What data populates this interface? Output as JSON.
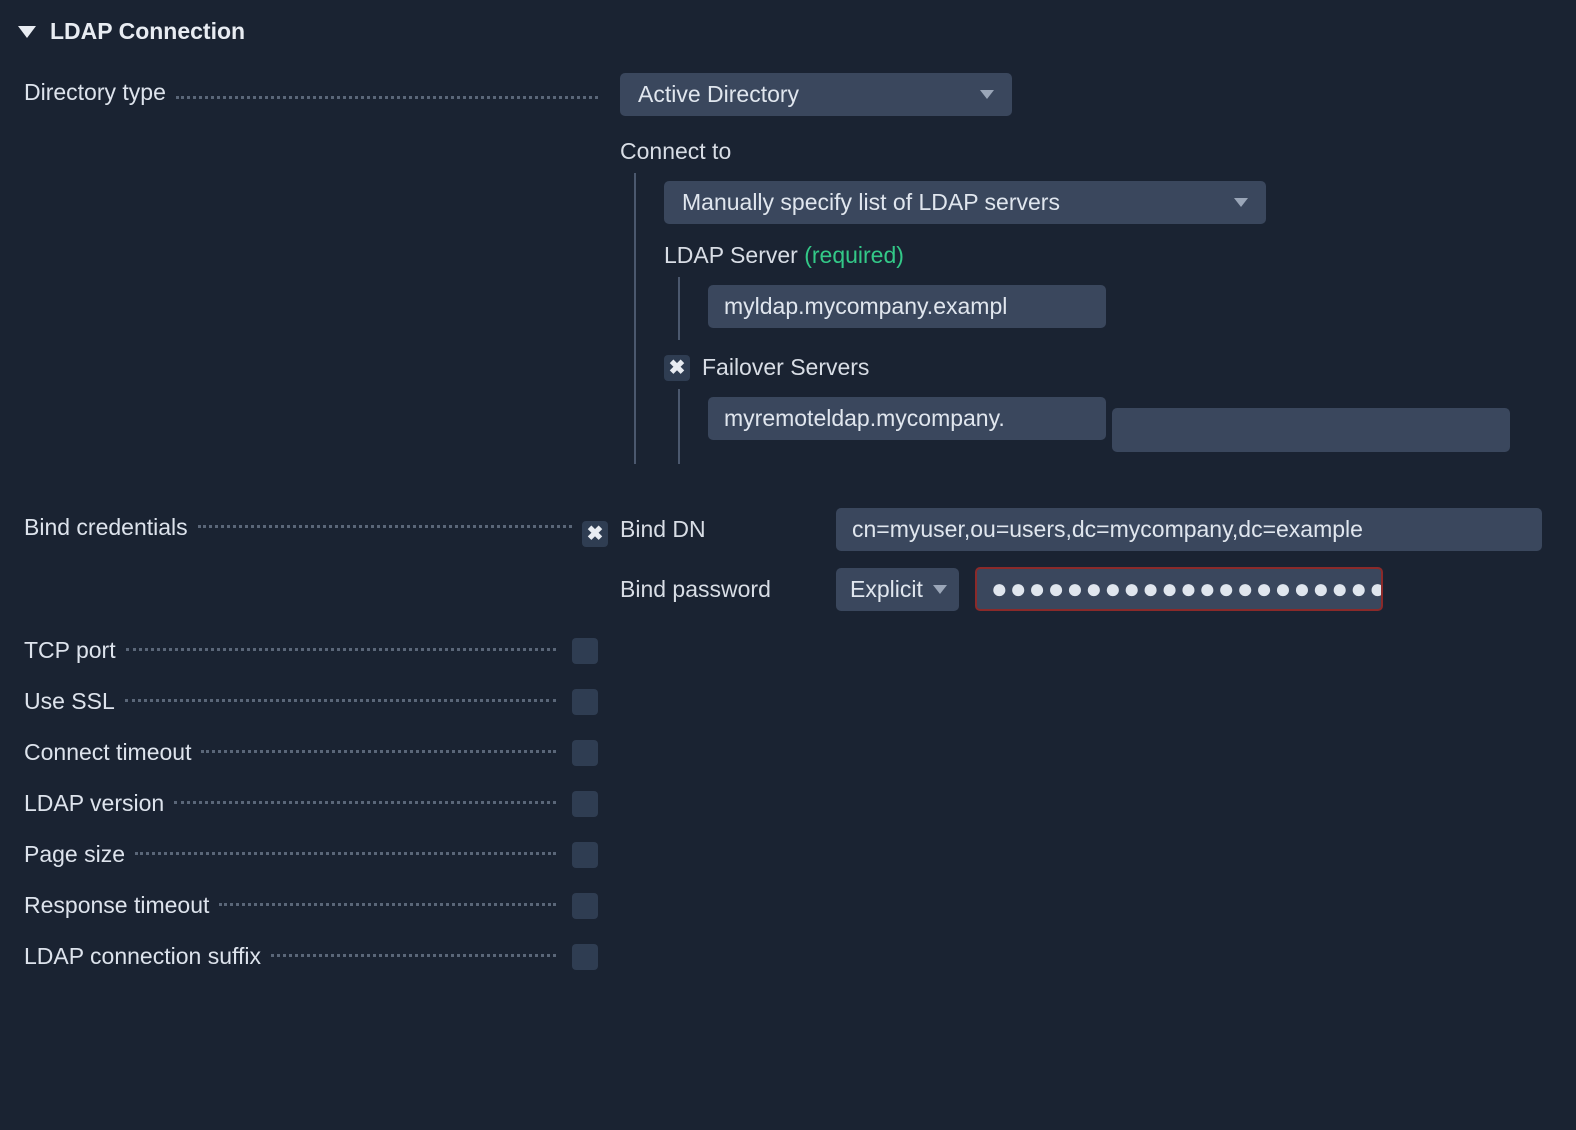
{
  "section_title": "LDAP Connection",
  "directory_type": {
    "label": "Directory type",
    "selected": "Active Directory"
  },
  "connect_to": {
    "label": "Connect to",
    "selected": "Manually specify list of LDAP servers"
  },
  "ldap_server": {
    "label": "LDAP Server",
    "required_text": "(required)",
    "value": "myldap.mycompany.exampl"
  },
  "failover": {
    "label": "Failover Servers",
    "values": [
      "myremoteldap.mycompany.",
      ""
    ]
  },
  "bind": {
    "label": "Bind credentials",
    "dn_label": "Bind DN",
    "dn_value": "cn=myuser,ou=users,dc=mycompany,dc=example",
    "pw_label": "Bind password",
    "pw_mode": "Explicit",
    "pw_masked": "●●●●●●●●●●●●●●●●●●●●●"
  },
  "options": [
    "TCP port",
    "Use SSL",
    "Connect timeout",
    "LDAP version",
    "Page size",
    "Response timeout",
    "LDAP connection suffix"
  ]
}
